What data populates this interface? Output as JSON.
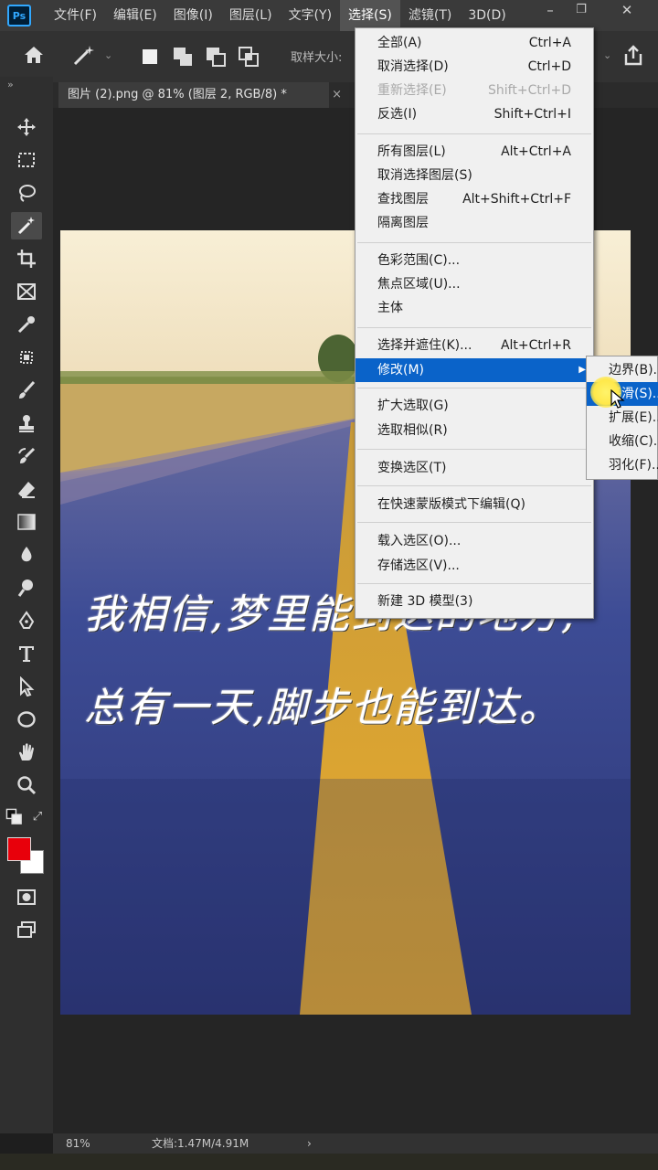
{
  "app": {
    "logo": "Ps",
    "menus": [
      "文件(F)",
      "编辑(E)",
      "图像(I)",
      "图层(L)",
      "文字(Y)",
      "选择(S)",
      "滤镜(T)",
      "3D(D)"
    ],
    "window_controls": [
      "minimize-icon",
      "restore-icon",
      "close-icon"
    ]
  },
  "options_bar": {
    "sample_label": "取样大小:",
    "icons": [
      "home-icon",
      "magic-wand-icon",
      "chevron-down-icon",
      "new-selection-icon",
      "add-selection-icon",
      "subtract-selection-icon",
      "intersect-selection-icon",
      "share-icon"
    ]
  },
  "document": {
    "tab_title": "图片 (2).png @ 81% (图层 2, RGB/8) *",
    "tab_close": "×",
    "caption_line1": "我相信,梦里能到达的地方,",
    "caption_line2": "总有一天,脚步也能到达。"
  },
  "select_menu": {
    "items": [
      {
        "label": "全部(A)",
        "shortcut": "Ctrl+A"
      },
      {
        "label": "取消选择(D)",
        "shortcut": "Ctrl+D"
      },
      {
        "label": "重新选择(E)",
        "shortcut": "Shift+Ctrl+D",
        "disabled": true
      },
      {
        "label": "反选(I)",
        "shortcut": "Shift+Ctrl+I"
      },
      {
        "label": "所有图层(L)",
        "shortcut": "Alt+Ctrl+A"
      },
      {
        "label": "取消选择图层(S)",
        "shortcut": ""
      },
      {
        "label": "查找图层",
        "shortcut": "Alt+Shift+Ctrl+F"
      },
      {
        "label": "隔离图层",
        "shortcut": ""
      },
      {
        "label": "色彩范围(C)...",
        "shortcut": ""
      },
      {
        "label": "焦点区域(U)...",
        "shortcut": ""
      },
      {
        "label": "主体",
        "shortcut": ""
      },
      {
        "label": "选择并遮住(K)...",
        "shortcut": "Alt+Ctrl+R"
      },
      {
        "label": "修改(M)",
        "shortcut": "",
        "highlighted": true
      },
      {
        "label": "扩大选取(G)",
        "shortcut": ""
      },
      {
        "label": "选取相似(R)",
        "shortcut": ""
      },
      {
        "label": "变换选区(T)",
        "shortcut": ""
      },
      {
        "label": "在快速蒙版模式下编辑(Q)",
        "shortcut": ""
      },
      {
        "label": "载入选区(O)...",
        "shortcut": ""
      },
      {
        "label": "存储选区(V)...",
        "shortcut": ""
      },
      {
        "label": "新建 3D 模型(3)",
        "shortcut": ""
      }
    ]
  },
  "modify_submenu": {
    "items": [
      "边界(B)...",
      "平滑(S)...",
      "扩展(E)...",
      "收缩(C)...",
      "羽化(F)..."
    ],
    "highlighted_index": 1
  },
  "status": {
    "zoom": "81%",
    "doc_size": "文档:1.47M/4.91M",
    "arrow": "›"
  },
  "colors": {
    "foreground": "#e8000b",
    "background": "#ffffff",
    "menu_highlight": "#0a63c9"
  }
}
